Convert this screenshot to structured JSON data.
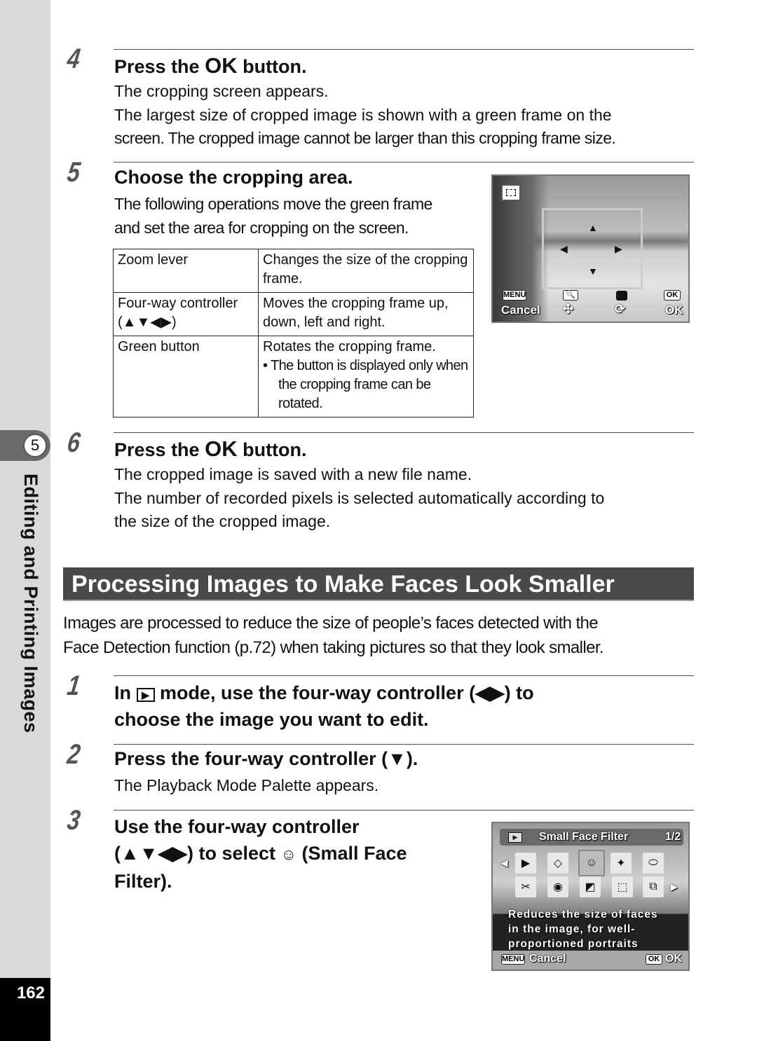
{
  "sidebar": {
    "chapter_number": "5",
    "chapter_title": "Editing and Printing Images",
    "page_number": "162"
  },
  "steps_top": [
    {
      "number": "4",
      "heading_pre": "Press the ",
      "heading_ok": "OK",
      "heading_post": " button.",
      "lines": [
        "The cropping screen appears.",
        "The largest size of cropped image is shown with a green frame on the",
        "screen. The cropped image cannot be larger than this cropping frame size."
      ]
    },
    {
      "number": "5",
      "heading": "Choose the cropping area.",
      "lines": [
        "The following operations move the green frame",
        "and set the area for cropping on the screen."
      ]
    },
    {
      "number": "6",
      "heading_pre": "Press the ",
      "heading_ok": "OK",
      "heading_post": " button.",
      "lines": [
        "The cropped image is saved with a new file name.",
        "The number of recorded pixels is selected automatically according to",
        "the size of the cropped image."
      ]
    }
  ],
  "operations_table": {
    "rows": [
      {
        "control": "Zoom lever",
        "action": "Changes the size of the cropping frame."
      },
      {
        "control": "Four-way controller (▲▼◀▶)",
        "action": "Moves the cropping frame up, down, left and right."
      },
      {
        "control": "Green button",
        "action": "Rotates the cropping frame.",
        "note": "• The button is displayed only when the cropping frame can be rotated."
      }
    ]
  },
  "crop_screen": {
    "menu_key": "MENU",
    "cancel_label": "Cancel",
    "ok_key": "OK",
    "ok_label": "OK"
  },
  "section": {
    "title": "Processing Images to Make Faces Look Smaller",
    "intro_lines": [
      "Images are processed to reduce the size of people’s faces detected with the",
      "Face Detection function (p.72) when taking pictures so that they look smaller."
    ]
  },
  "steps_bottom": [
    {
      "number": "1",
      "line1_pre": "In ",
      "line1_post": " mode, use the four-way controller (◀▶) to",
      "line2": "choose the image you want to edit."
    },
    {
      "number": "2",
      "heading": "Press the four-way controller (▼).",
      "lines": [
        "The Playback Mode Palette appears."
      ]
    },
    {
      "number": "3",
      "line1": "Use the four-way controller",
      "line2_pre": "(▲▼◀▶) to select ",
      "line2_post": " (Small Face",
      "line3": "Filter)."
    }
  ],
  "palette_screen": {
    "title": "Small Face Filter",
    "page": "1/2",
    "description_lines": [
      "Reduces the size of faces",
      "in the image, for well-",
      "proportioned portraits"
    ],
    "menu_key": "MENU",
    "cancel_label": "Cancel",
    "ok_key": "OK",
    "ok_label": "OK"
  }
}
